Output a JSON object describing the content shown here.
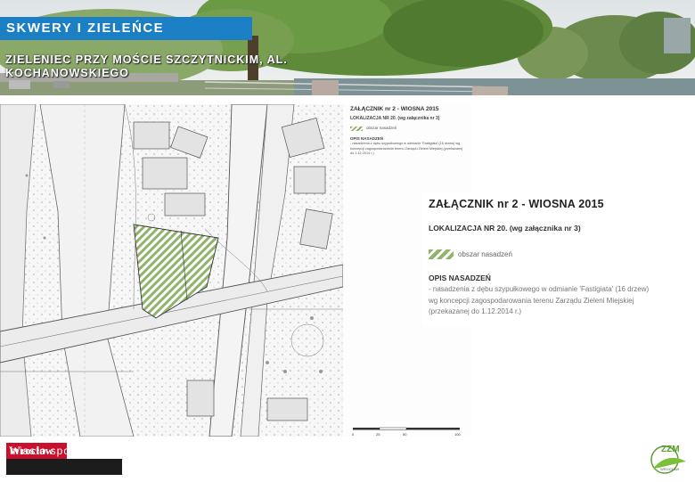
{
  "header": {
    "title": "SKWERY I ZIELEŃCE",
    "subtitle": "ZIELENIEC PRZY MOŚCIE SZCZYTNICKIM, AL. KOCHANOWSKIEGO",
    "accent_color": "#1a7fc4"
  },
  "map_legend_small": {
    "title": "ZAŁĄCZNIK nr 2 - WIOSNA 2015",
    "location": "LOKALIZACJA NR 20. (wg załącznika nr 3)",
    "swatch_label": "obszar nasadzeń",
    "opis_title": "OPIS NASADZEŃ",
    "description": "- nasadzenia z dębu szypułkowego w odmianie 'Fastigiata' (16 drzew) wg koncepcji zagospodarowania terenu Zarządu Zieleni Miejskiej (przekazanej do 1.12.2014 r.)"
  },
  "legend": {
    "title": "ZAŁĄCZNIK nr 2 - WIOSNA 2015",
    "location": "LOKALIZACJA NR 20. (wg załącznika nr 3)",
    "swatch_label": "obszar nasadzeń",
    "opis_title": "OPIS NASADZEŃ",
    "description": "- nasadzenia z dębu szypułkowego w odmianie 'Fastigiata' (16 drzew) wg koncepcji zagospodarowania terenu Zarządu Zieleni Miejskiej (przekazanej do 1.12.2014 r.)"
  },
  "scale": {
    "ticks": [
      "0",
      "25",
      "50",
      "100"
    ]
  },
  "footer": {
    "logo_top": "Wrocław",
    "logo_bottom": "miasto spotkań",
    "logo_right": "ZZM",
    "logo_right_sub": "WROCŁAW"
  }
}
